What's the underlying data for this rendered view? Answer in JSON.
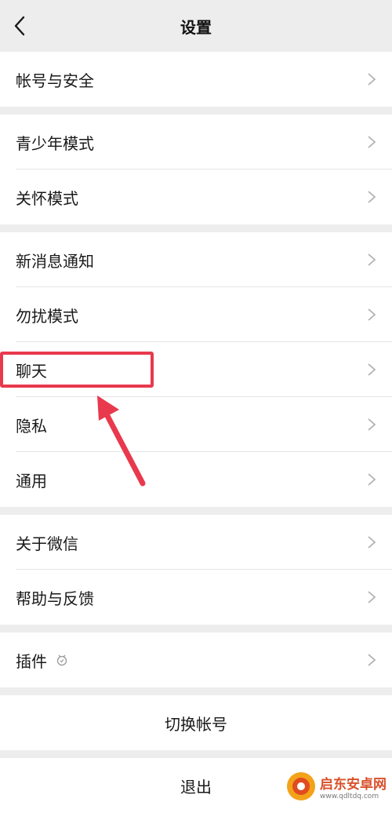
{
  "header": {
    "title": "设置",
    "back_icon": "chevron-left-icon"
  },
  "groups": [
    {
      "items": [
        {
          "label": "帐号与安全"
        }
      ]
    },
    {
      "items": [
        {
          "label": "青少年模式"
        },
        {
          "label": "关怀模式"
        }
      ]
    },
    {
      "items": [
        {
          "label": "新消息通知"
        },
        {
          "label": "勿扰模式"
        },
        {
          "label": "聊天"
        },
        {
          "label": "隐私"
        },
        {
          "label": "通用"
        }
      ]
    },
    {
      "items": [
        {
          "label": "关于微信"
        },
        {
          "label": "帮助与反馈"
        }
      ]
    },
    {
      "items": [
        {
          "label": "插件"
        }
      ]
    }
  ],
  "actions": {
    "switch_account": "切换帐号",
    "logout": "退出"
  },
  "annotation": {
    "highlight_color": "#e8394d",
    "target": "聊天"
  },
  "watermark": {
    "name": "启东安卓网",
    "url": "www.qdltdq.com"
  }
}
